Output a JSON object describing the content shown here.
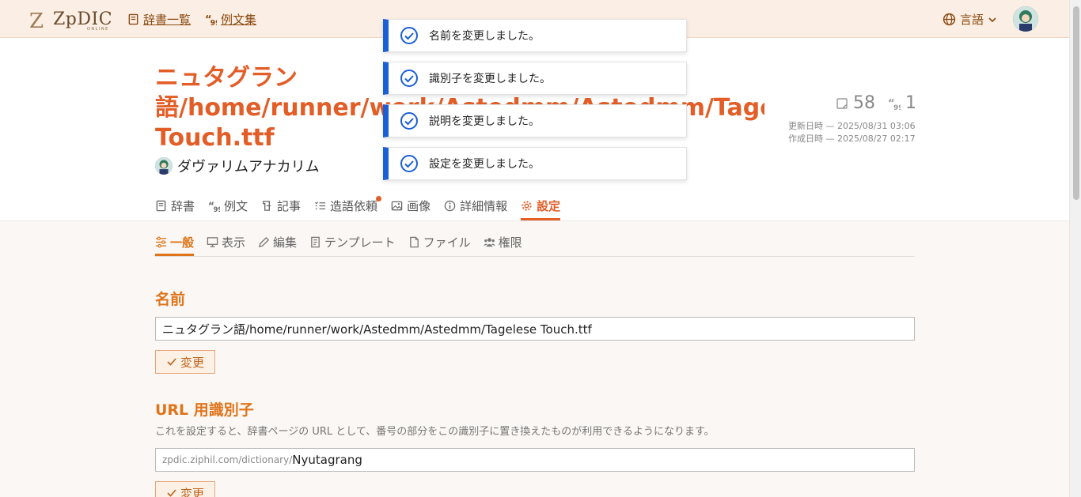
{
  "header": {
    "logo_main": "ZpDIC",
    "logo_sub": "ONLINE",
    "dictionary_list_label": "辞書一覧",
    "example_collection_label": "例文集",
    "language_label": "言語"
  },
  "dictionary": {
    "title_lines": [
      "ニュタグラン",
      "語/home/runner/work/Astedmm/Astedmm/Tagelese",
      "Touch.ttf"
    ],
    "author": "ダヴァリムアナカリム",
    "word_count": "58",
    "example_count": "1",
    "updated_label": "更新日時 — 2025/08/31 03:06",
    "created_label": "作成日時 — 2025/08/27 02:17"
  },
  "tabs": [
    {
      "label": "辞書",
      "icon": "book-icon"
    },
    {
      "label": "例文",
      "icon": "quote-icon"
    },
    {
      "label": "記事",
      "icon": "article-icon"
    },
    {
      "label": "造語依頼",
      "icon": "list-icon"
    },
    {
      "label": "画像",
      "icon": "image-icon"
    },
    {
      "label": "詳細情報",
      "icon": "info-icon"
    },
    {
      "label": "設定",
      "icon": "gear-icon"
    }
  ],
  "subtabs": [
    {
      "label": "一般",
      "icon": "sliders-icon"
    },
    {
      "label": "表示",
      "icon": "monitor-icon"
    },
    {
      "label": "編集",
      "icon": "pencil-icon"
    },
    {
      "label": "テンプレート",
      "icon": "template-icon"
    },
    {
      "label": "ファイル",
      "icon": "file-icon"
    },
    {
      "label": "権限",
      "icon": "users-icon"
    }
  ],
  "settings": {
    "name_heading": "名前",
    "name_value": "ニュタグラン語/home/runner/work/Astedmm/Astedmm/Tagelese Touch.ttf",
    "change_label": "変更",
    "url_heading": "URL 用識別子",
    "url_description": "これを設定すると、辞書ページの URL として、番号の部分をこの識別子に置き換えたものが利用できるようになります。",
    "url_prefix": "zpdic.ziphil.com/dictionary/",
    "url_value": "Nyutagrang"
  },
  "toasts": [
    "名前を変更しました。",
    "識別子を変更しました。",
    "説明を変更しました。",
    "設定を変更しました。"
  ],
  "colors": {
    "accent": "#e35d27",
    "sub_accent": "#e0741a",
    "toast": "#1a5fd6",
    "header_bg": "#fbeee4"
  }
}
